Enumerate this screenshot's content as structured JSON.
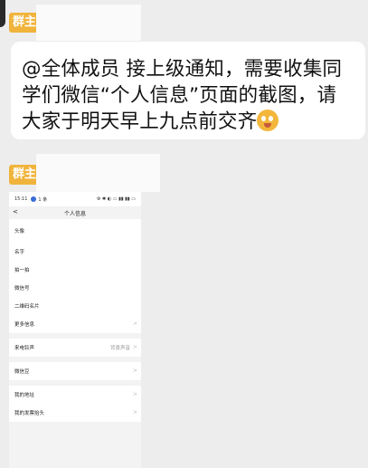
{
  "msg1": {
    "sender_badge": "群主",
    "text": "@全体成员 接上级通知，需要收集同学们微信“个人信息”页面的截图，请大家于明天早上九点前交齐"
  },
  "msg2": {
    "sender_badge": "群主"
  },
  "phone": {
    "status": {
      "time": "15:11",
      "badge": "1 条",
      "right": "⚙ ✱ ◐ ▭ ▮▮ ▮▮ ▭"
    },
    "nav": {
      "back": "<",
      "title": "个人信息"
    },
    "rows_group1": [
      {
        "label": "头像"
      },
      {
        "label": "名字"
      },
      {
        "label": "拍一拍"
      },
      {
        "label": "微信号"
      },
      {
        "label": "二维码名片"
      },
      {
        "label": "更多信息",
        "chevron": ">"
      }
    ],
    "rows_group2": [
      {
        "label": "来电铃声",
        "value": "背景声音",
        "chevron": ">"
      }
    ],
    "rows_group3": [
      {
        "label": "微信豆",
        "chevron": ">"
      }
    ],
    "rows_group4": [
      {
        "label": "我的地址",
        "chevron": ">"
      },
      {
        "label": "我的发票抬头",
        "chevron": ">"
      }
    ]
  }
}
